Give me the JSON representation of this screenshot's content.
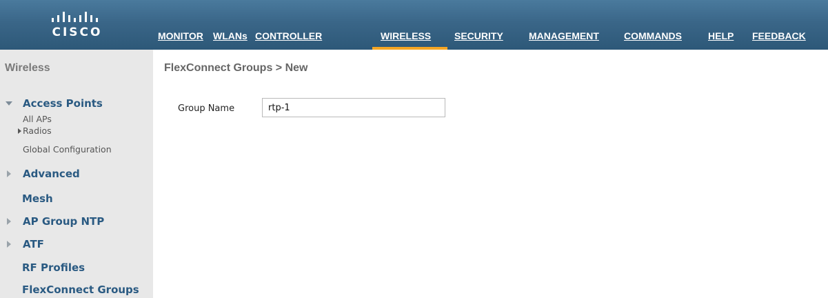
{
  "brand": {
    "wordmark": "CISCO"
  },
  "nav": {
    "items": [
      {
        "label": "MONITOR"
      },
      {
        "label": "WLANs"
      },
      {
        "label": "CONTROLLER"
      },
      {
        "label": "WIRELESS"
      },
      {
        "label": "SECURITY"
      },
      {
        "label": "MANAGEMENT"
      },
      {
        "label": "COMMANDS"
      },
      {
        "label": "HELP"
      },
      {
        "label": "FEEDBACK"
      }
    ],
    "active": "WIRELESS",
    "active_color": "#f5a623"
  },
  "sidebar": {
    "title": "Wireless",
    "access_points": {
      "label": "Access Points",
      "expanded": true,
      "children": [
        {
          "label": "All APs"
        },
        {
          "label": "Radios"
        },
        {
          "label": "Global Configuration"
        }
      ]
    },
    "items": [
      {
        "label": "Advanced",
        "expandable": true
      },
      {
        "label": "Mesh",
        "expandable": false
      },
      {
        "label": "AP Group NTP",
        "expandable": true
      },
      {
        "label": "ATF",
        "expandable": true
      },
      {
        "label": "RF Profiles",
        "expandable": false
      },
      {
        "label": "FlexConnect Groups",
        "expandable": false
      }
    ]
  },
  "main": {
    "title": "FlexConnect Groups > New",
    "form": {
      "group_name_label": "Group Name",
      "group_name_value": "rtp-1"
    }
  }
}
